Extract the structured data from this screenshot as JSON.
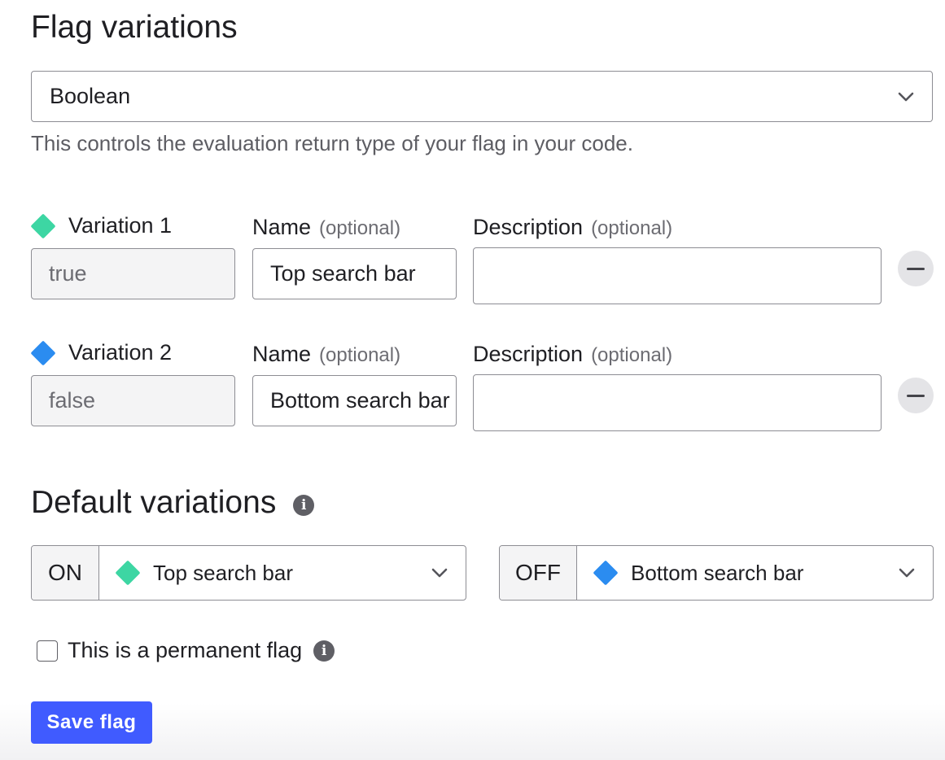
{
  "title": "Flag variations",
  "type_select": {
    "value": "Boolean",
    "helper": "This controls the evaluation return type of your flag in your code."
  },
  "variations": [
    {
      "label": "Variation 1",
      "color": "#3dd6a3",
      "value": "true",
      "name": "Top search bar",
      "description": ""
    },
    {
      "label": "Variation 2",
      "color": "#2b8cf0",
      "value": "false",
      "name": "Bottom search bar",
      "description": ""
    }
  ],
  "labels": {
    "name": "Name",
    "description": "Description",
    "optional": "(optional)"
  },
  "defaults": {
    "title": "Default variations",
    "on": {
      "tag": "ON",
      "value": "Top search bar",
      "color": "#3dd6a3"
    },
    "off": {
      "tag": "OFF",
      "value": "Bottom search bar",
      "color": "#2b8cf0"
    }
  },
  "permanent_flag": {
    "label": "This is a permanent flag",
    "checked": false
  },
  "save_label": "Save flag",
  "colors": {
    "primary": "#405bff",
    "variation1": "#3dd6a3",
    "variation2": "#2b8cf0"
  }
}
